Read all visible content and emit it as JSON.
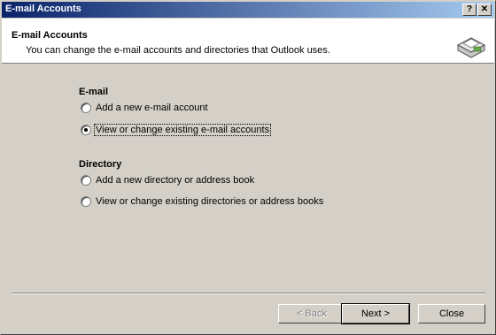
{
  "window": {
    "title": "E-mail Accounts",
    "help_label": "?",
    "close_label": "✕"
  },
  "header": {
    "title": "E-mail Accounts",
    "subtitle": "You can change the e-mail accounts and directories that Outlook uses.",
    "icon": "envelope-icon"
  },
  "email": {
    "heading": "E-mail",
    "options": [
      {
        "label": "Add a new e-mail account",
        "checked": false
      },
      {
        "label": "View or change existing e-mail accounts",
        "checked": true
      }
    ]
  },
  "directory": {
    "heading": "Directory",
    "options": [
      {
        "label": "Add a new directory or address book",
        "checked": false
      },
      {
        "label": "View or change existing directories or address books",
        "checked": false
      }
    ]
  },
  "buttons": {
    "back": "< Back",
    "next": "Next >",
    "close": "Close"
  }
}
